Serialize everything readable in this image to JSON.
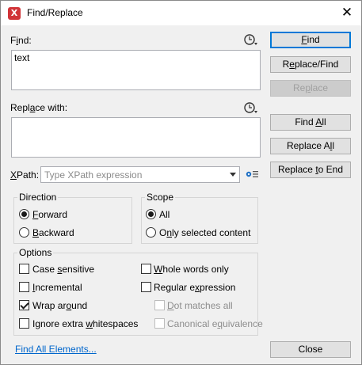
{
  "window": {
    "title": "Find/Replace",
    "app_icon": "xml-editor-icon",
    "close_glyph": "✕"
  },
  "find": {
    "label_pre": "F",
    "label_ul": "i",
    "label_post": "nd:",
    "value": "text",
    "history_icon": "history-clock-icon"
  },
  "replace": {
    "label_pre": "Repl",
    "label_ul": "a",
    "label_post": "ce with:",
    "value": "",
    "history_icon": "history-clock-icon"
  },
  "xpath": {
    "label_ul": "X",
    "label_post": "Path:",
    "placeholder": "Type XPath expression",
    "settings_icon": "gear-settings-icon"
  },
  "buttons": {
    "find_ul": "F",
    "find_post": "ind",
    "replace_find_pre": "R",
    "replace_find_ul": "e",
    "replace_find_post": "place/Find",
    "replace_pre": "Re",
    "replace_ul": "p",
    "replace_post": "lace",
    "find_all_pre": "Find ",
    "find_all_ul": "A",
    "find_all_post": "ll",
    "replace_all_pre": "Replace A",
    "replace_all_ul": "l",
    "replace_all_post": "l",
    "replace_to_end_pre": "Replace ",
    "replace_to_end_ul": "t",
    "replace_to_end_post": "o End",
    "close": "Close"
  },
  "direction": {
    "title": "Direction",
    "forward_ul": "F",
    "forward_post": "orward",
    "backward_ul": "B",
    "backward_post": "ackward",
    "selected": "forward"
  },
  "scope": {
    "title": "Scope",
    "all": "All",
    "only_pre": "O",
    "only_ul": "n",
    "only_post": "ly selected content",
    "selected": "all"
  },
  "options": {
    "title": "Options",
    "case_sensitive": {
      "pre": "Case ",
      "ul": "s",
      "post": "ensitive",
      "checked": false
    },
    "whole_words": {
      "pre": "",
      "ul": "W",
      "post": "hole words only",
      "checked": false
    },
    "incremental": {
      "pre": "",
      "ul": "I",
      "post": "ncremental",
      "checked": false
    },
    "regex": {
      "pre": "Regular e",
      "ul": "x",
      "post": "pression",
      "checked": false
    },
    "wrap_around": {
      "pre": "Wrap ar",
      "ul": "o",
      "post": "und",
      "checked": true
    },
    "dot_matches": {
      "pre": "",
      "ul": "D",
      "post": "ot matches all",
      "checked": false,
      "disabled": true
    },
    "ignore_ws": {
      "pre": "Ignore extra ",
      "ul": "w",
      "post": "hitespaces",
      "checked": false
    },
    "canonical": {
      "pre": "Canonical e",
      "ul": "q",
      "post": "uivalence",
      "checked": false,
      "disabled": true
    }
  },
  "footer": {
    "find_all_elements": "Find All Elements..."
  }
}
